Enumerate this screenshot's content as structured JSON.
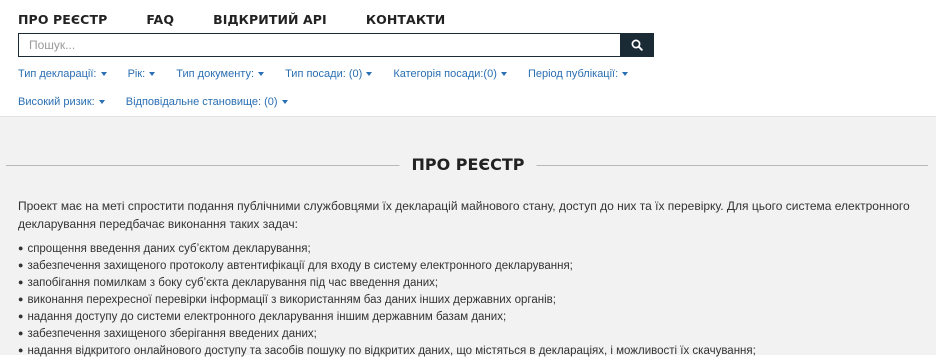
{
  "nav": {
    "about": "ПРО РЕЄСТР",
    "faq": "FAQ",
    "api": "ВІДКРИТИЙ API",
    "contacts": "КОНТАКТИ"
  },
  "search": {
    "placeholder": "Пошук..."
  },
  "filters": {
    "declaration_type": "Тип декларації:",
    "year": "Рік:",
    "document_type": "Тип документу:",
    "position_type": "Тип посади: (0)",
    "position_category": "Категорія посади:(0)",
    "publication_period": "Період публікації:",
    "high_risk": "Високий ризик:",
    "responsible_position": "Відповідальне становище: (0)"
  },
  "content": {
    "title": "ПРО РЕЄСТР",
    "intro": "Проект має на меті спростити подання публічними службовцями їх декларацій майнового стану, доступ до них та їх перевірку. Для цього система електронного декларування передбачає виконання таких задач:",
    "tasks": [
      "спрощення введення даних суб’єктом декларування;",
      "забезпечення захищеного протоколу автентифікації для входу в систему електронного декларування;",
      "запобігання помилкам з боку суб’єкта декларування під час введення даних;",
      "виконання перехресної перевірки інформації з використанням баз даних інших державних органів;",
      "надання доступу до системи електронного декларування іншим державним базам даних;",
      "забезпечення захищеного зберігання введених даних;",
      "надання відкритого онлайнового доступу та засобів пошуку по відкритих даних, що містяться в деклараціях, і можливості їх скачування;"
    ]
  },
  "colors": {
    "accent": "#1b2b36",
    "link": "#2a6fb3",
    "content_bg": "#f2f2f2"
  }
}
